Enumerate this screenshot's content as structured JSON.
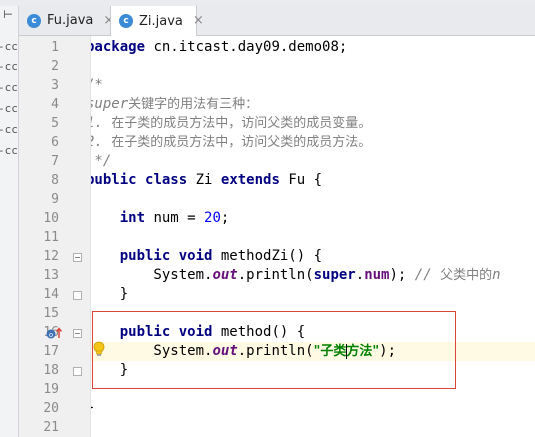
{
  "left_panel": {
    "collapse_glyph": "⊢",
    "items": [
      "-cc",
      "-cc",
      "-cc",
      "-cc",
      "-cc",
      "-cc"
    ]
  },
  "tabs": [
    {
      "label": "Fu.java",
      "icon": "class-icon",
      "icon_letter": "c",
      "active": false
    },
    {
      "label": "Zi.java",
      "icon": "class-icon",
      "icon_letter": "c",
      "active": true
    }
  ],
  "tab_close_glyph": "×",
  "editor": {
    "line_numbers": [
      "1",
      "2",
      "3",
      "4",
      "5",
      "6",
      "7",
      "8",
      "9",
      "10",
      "11",
      "12",
      "13",
      "14",
      "15",
      "16",
      "17",
      "18",
      "19",
      "20",
      "21"
    ],
    "current_line": 17,
    "lines": {
      "l1_kw": "package",
      "l1_rest": " cn.itcast.day09.demo08;",
      "l3": "/*",
      "l4_tag": "super",
      "l4_text": "关键字的用法有三种：",
      "l5_num": "1. ",
      "l5_text": "在子类的成员方法中，访问父类的成员变量。",
      "l6_num": "2. ",
      "l6_text": "在子类的成员方法中，访问父类的成员方法。",
      "l7": " */",
      "l8_kw1": "public",
      "l8_kw2": "class",
      "l8_name": " Zi ",
      "l8_kw3": "extends",
      "l8_rest": " Fu {",
      "l10_indent": "    ",
      "l10_kw": "int",
      "l10_mid": " num = ",
      "l10_num": "20",
      "l10_end": ";",
      "l12_indent": "    ",
      "l12_kw1": "public",
      "l12_kw2": "void",
      "l12_rest": " methodZi() {",
      "l13_indent": "        System.",
      "l13_static": "out",
      "l13_mid": ".println(",
      "l13_kw": "super",
      "l13_dot": ".",
      "l13_fld": "num",
      "l13_end": "); ",
      "l13_cm": "// ",
      "l13_cm_cn": "父类中的",
      "l13_cm_tail": "n",
      "l14": "    }",
      "l16_indent": "    ",
      "l16_kw1": "public",
      "l16_kw2": "void",
      "l16_rest": " method() {",
      "l17_indent": "        System.",
      "l17_static": "out",
      "l17_mid": ".println(",
      "l17_str_a": "\"子类",
      "l17_str_b": "方法\"",
      "l17_end": ");",
      "l18": "    }",
      "l20": "}"
    }
  },
  "colors": {
    "keyword": "#000080",
    "comment": "#808080",
    "string": "#008000",
    "number": "#0000ff",
    "field": "#660e7a",
    "annotation_box": "#d9453a",
    "current_line": "#fffae3"
  }
}
